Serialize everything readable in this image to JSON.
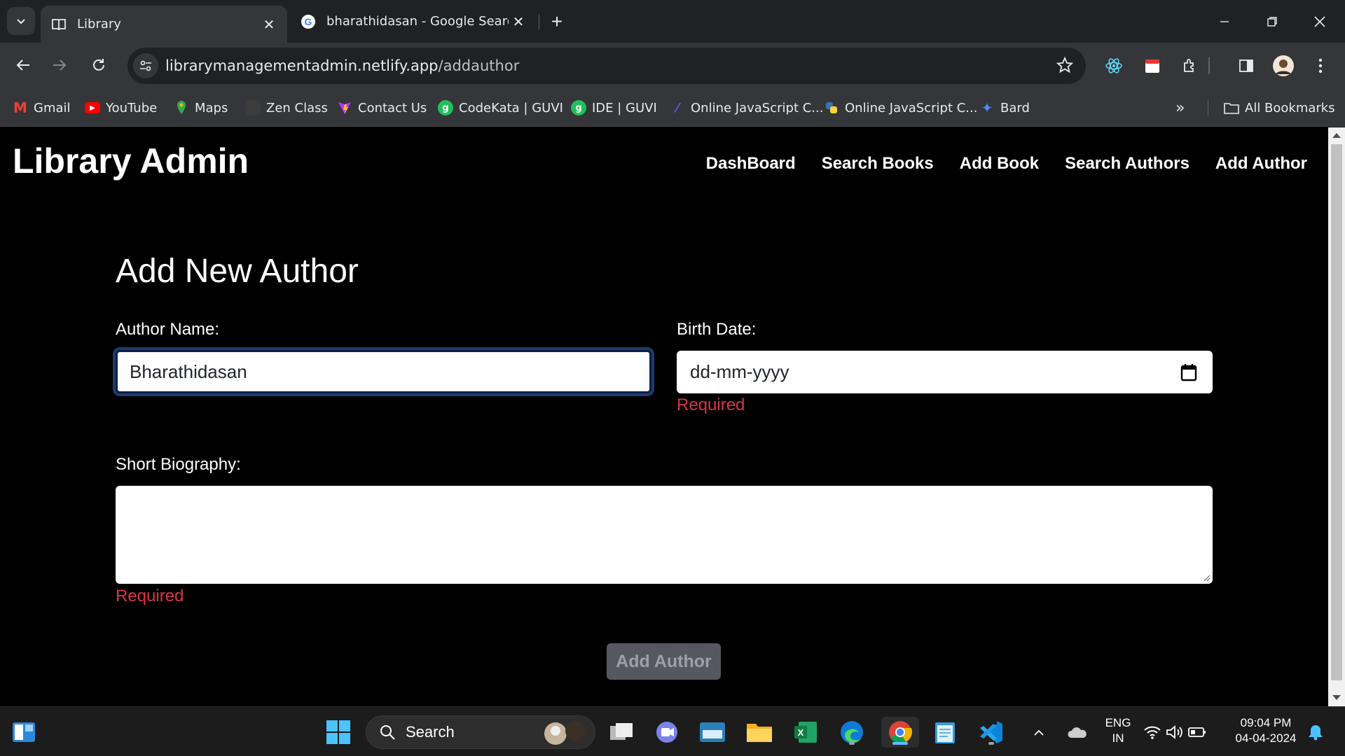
{
  "browser": {
    "tabs": [
      {
        "title": "Library",
        "icon": "book-icon",
        "active": true
      },
      {
        "title": "bharathidasan - Google Search",
        "icon": "google-icon",
        "active": false
      }
    ],
    "url_host": "librarymanagementadmin.netlify.app",
    "url_path": "/addauthor",
    "bookmarks": [
      {
        "label": "Gmail",
        "icon": "gmail-icon",
        "color": "#ea4335"
      },
      {
        "label": "YouTube",
        "icon": "youtube-icon",
        "color": "#ff0000"
      },
      {
        "label": "Maps",
        "icon": "maps-icon",
        "color": "#34a853"
      },
      {
        "label": "Zen Class",
        "icon": "zen-class-icon",
        "color": "#3c3c3c"
      },
      {
        "label": "Contact Us",
        "icon": "vite-icon",
        "color": "#bd34fe"
      },
      {
        "label": "CodeKata | GUVI",
        "icon": "guvi-icon",
        "color": "#20c05c"
      },
      {
        "label": "IDE | GUVI",
        "icon": "guvi-icon",
        "color": "#20c05c"
      },
      {
        "label": "Online JavaScript C...",
        "icon": "programiz-icon",
        "color": "#6b4bff"
      },
      {
        "label": "Online JavaScript C...",
        "icon": "python-icon",
        "color": "#3776ab"
      },
      {
        "label": "Bard",
        "icon": "bard-icon",
        "color": "#4f8bf9"
      }
    ],
    "all_bookmarks": "All Bookmarks"
  },
  "app": {
    "brand": "Library Admin",
    "nav": [
      "DashBoard",
      "Search Books",
      "Add Book",
      "Search Authors",
      "Add Author"
    ]
  },
  "form": {
    "title": "Add New Author",
    "author_name_label": "Author Name:",
    "author_name_value": "Bharathidasan",
    "birth_date_label": "Birth Date:",
    "birth_date_placeholder": "dd-mm-yyyy",
    "birth_date_error": "Required",
    "bio_label": "Short Biography:",
    "bio_value": "",
    "bio_error": "Required",
    "submit_label": "Add Author"
  },
  "taskbar": {
    "search_placeholder": "Search",
    "lang_line1": "ENG",
    "lang_line2": "IN",
    "time": "09:04 PM",
    "date": "04-04-2024"
  },
  "colors": {
    "error": "#dc3545",
    "page_bg": "#000000",
    "button_disabled": "#55595f"
  }
}
